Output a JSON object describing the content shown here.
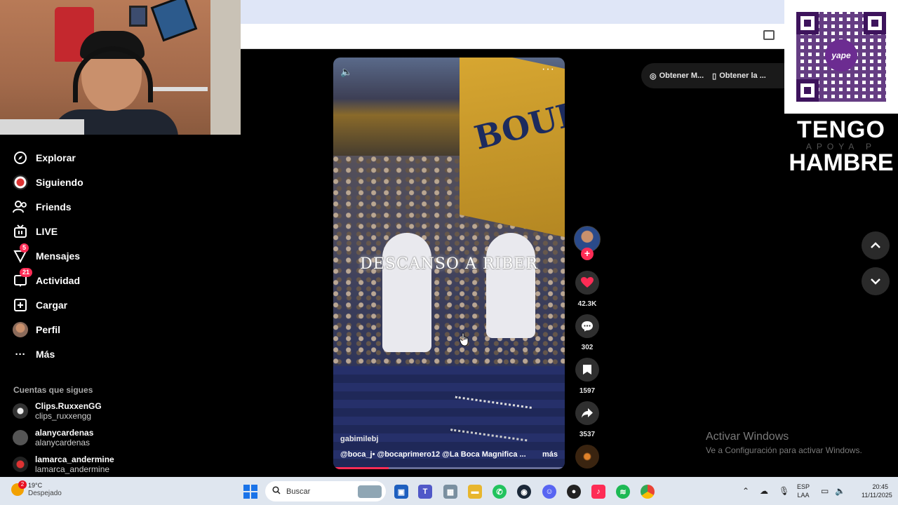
{
  "sidebar": {
    "items": [
      {
        "label": "Explorar",
        "icon": "compass-icon"
      },
      {
        "label": "Siguiendo",
        "icon": "following-avatar-icon"
      },
      {
        "label": "Friends",
        "icon": "friends-icon"
      },
      {
        "label": "LIVE",
        "icon": "live-tv-icon"
      },
      {
        "label": "Mensajes",
        "icon": "messages-icon",
        "badge": "5"
      },
      {
        "label": "Actividad",
        "icon": "activity-icon",
        "badge": "21"
      },
      {
        "label": "Cargar",
        "icon": "upload-plus-icon"
      },
      {
        "label": "Perfil",
        "icon": "profile-avatar-icon"
      },
      {
        "label": "Más",
        "icon": "more-dots-icon"
      }
    ],
    "following_title": "Cuentas que sigues",
    "following": [
      {
        "name": "Clips.RuxxenGG",
        "handle": "clips_ruxxengg"
      },
      {
        "name": "alanycardenas",
        "handle": "alanycardenas"
      },
      {
        "name": "lamarca_andermine",
        "handle": "lamarca_andermine"
      }
    ]
  },
  "overlay": {
    "qr_logo": "yape",
    "line1": "TENGO",
    "line2": "APOYA P",
    "line3": "HAMBRE"
  },
  "video": {
    "caption": "DESCANSO A RIBER",
    "author": "gabimilebj",
    "tags": "@boca_j•  @bocaprimero12  @La Boca Magnifica  ...",
    "more": "más",
    "progress": 0.24
  },
  "actions": {
    "likes": "42.3K",
    "comments": "302",
    "saves": "1597",
    "shares": "3537"
  },
  "top_pills": [
    {
      "label": "Obtener M...",
      "icon": "coin-icon"
    },
    {
      "label": "Obtener la ...",
      "icon": "phone-icon"
    }
  ],
  "activate": {
    "title": "Activar Windows",
    "subtitle": "Ve a Configuración para activar Windows."
  },
  "taskbar": {
    "temp": "19°C",
    "condition": "Despejado",
    "weather_badge": "2",
    "search_placeholder": "Buscar",
    "lang_top": "ESP",
    "lang_bottom": "LAA",
    "time": "20:45",
    "date": "11/11/2025"
  }
}
